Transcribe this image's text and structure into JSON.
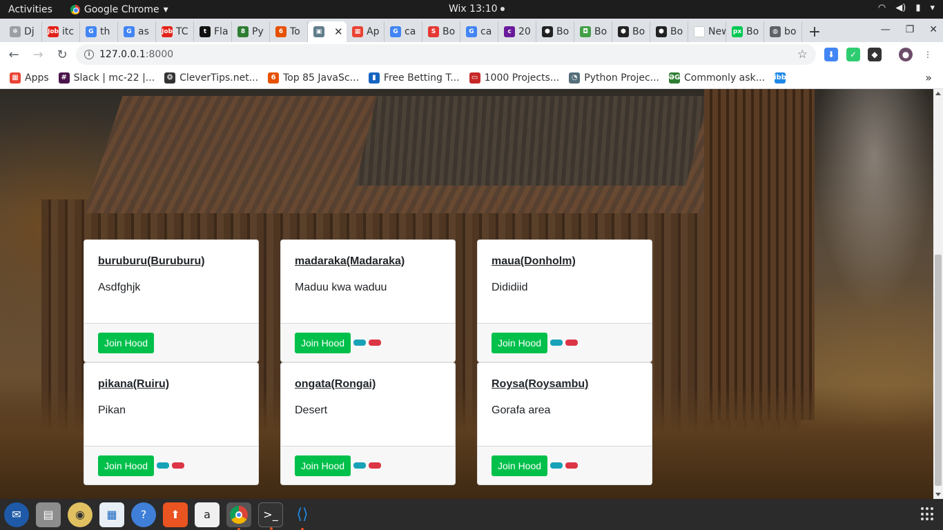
{
  "system": {
    "activities": "Activities",
    "app_name": "Google Chrome",
    "clock": "Wix 13:10"
  },
  "tabs": [
    {
      "label": "Dj",
      "color": "#9aa0a6",
      "glyph": "✻"
    },
    {
      "label": "itc",
      "color": "#e2231a",
      "glyph": "Job"
    },
    {
      "label": "th",
      "color": "#4285f4",
      "glyph": "G"
    },
    {
      "label": "as",
      "color": "#4285f4",
      "glyph": "G"
    },
    {
      "label": "TC",
      "color": "#e2231a",
      "glyph": "Job"
    },
    {
      "label": "Fla",
      "color": "#111111",
      "glyph": "t"
    },
    {
      "label": "Py",
      "color": "#2e7d32",
      "glyph": "8"
    },
    {
      "label": "To",
      "color": "#e65100",
      "glyph": "6"
    },
    {
      "label": "",
      "color": "#607d8b",
      "glyph": "▣",
      "active": true
    },
    {
      "label": "Ap",
      "color": "#ea4335",
      "glyph": "▦"
    },
    {
      "label": "ca",
      "color": "#4285f4",
      "glyph": "G"
    },
    {
      "label": "Bo",
      "color": "#e53935",
      "glyph": "S"
    },
    {
      "label": "ca",
      "color": "#4285f4",
      "glyph": "G"
    },
    {
      "label": "20",
      "color": "#6a1b9a",
      "glyph": "c"
    },
    {
      "label": "Bo",
      "color": "#222222",
      "glyph": "⬢"
    },
    {
      "label": "Bo",
      "color": "#43a047",
      "glyph": "◘"
    },
    {
      "label": "Bo",
      "color": "#222222",
      "glyph": "⬢"
    },
    {
      "label": "Bo",
      "color": "#222222",
      "glyph": "⬢"
    },
    {
      "label": "New T",
      "color": "#ffffff",
      "glyph": ""
    },
    {
      "label": "Bo",
      "color": "#00c853",
      "glyph": "px"
    },
    {
      "label": "bo",
      "color": "#5f6368",
      "glyph": "◍"
    }
  ],
  "toolbar": {
    "url_host": "127.0.0.1",
    "url_port": ":8000"
  },
  "bookmarks": [
    {
      "label": "Apps",
      "color": "#ea4335",
      "glyph": "▦"
    },
    {
      "label": "Slack | mc-22 |...",
      "color": "#4a154b",
      "glyph": "#"
    },
    {
      "label": "CleverTips.net...",
      "color": "#333333",
      "glyph": "❂"
    },
    {
      "label": "Top 85 JavaSc...",
      "color": "#e65100",
      "glyph": "6"
    },
    {
      "label": "Free Betting T...",
      "color": "#1565c0",
      "glyph": "▮"
    },
    {
      "label": "1000 Projects...",
      "color": "#c62828",
      "glyph": "▭"
    },
    {
      "label": "Python Projec...",
      "color": "#546e7a",
      "glyph": "◔"
    },
    {
      "label": "Commonly ask...",
      "color": "#2e7d32",
      "glyph": "ƏG"
    },
    {
      "label": "",
      "color": "#1e88e5",
      "glyph": "ibb"
    }
  ],
  "hoods": [
    {
      "name": "buruburu(Buruburu)",
      "description": "Asdfghjk",
      "button": "Join Hood",
      "pills": false
    },
    {
      "name": "madaraka(Madaraka)",
      "description": "Maduu kwa waduu",
      "button": "Join Hood",
      "pills": true
    },
    {
      "name": "maua(Donholm)",
      "description": "Dididiid",
      "button": "Join Hood",
      "pills": true
    },
    {
      "name": "pikana(Ruiru)",
      "description": "Pikan",
      "button": "Join Hood",
      "pills": true
    },
    {
      "name": "ongata(Rongai)",
      "description": "Desert",
      "button": "Join Hood",
      "pills": true
    },
    {
      "name": "Roysa(Roysambu)",
      "description": "Gorafa area",
      "button": "Join Hood",
      "pills": true
    }
  ],
  "colors": {
    "join_button": "#00c04b",
    "pill_info": "#17a2b8",
    "pill_danger": "#dc3545"
  }
}
